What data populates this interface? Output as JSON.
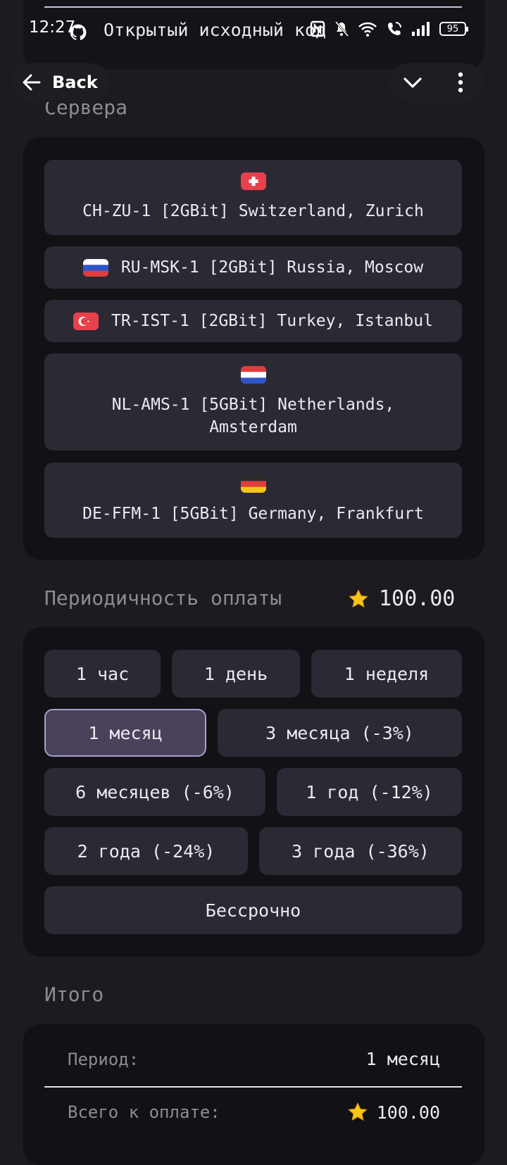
{
  "status_bar": {
    "time": "12:27",
    "battery": "95"
  },
  "top_card": {
    "title": "Открытый исходный код"
  },
  "nav": {
    "back_label": "Back"
  },
  "servers": {
    "section_title": "Сервера",
    "items": [
      {
        "label": "CH-ZU-1 [2GBit] Switzerland, Zurich",
        "flag": "switzerland-flag"
      },
      {
        "label": "RU-MSK-1 [2GBit] Russia, Moscow",
        "flag": "russia-flag"
      },
      {
        "label": "TR-IST-1 [2GBit] Turkey, Istanbul",
        "flag": "turkey-flag"
      },
      {
        "label_line1": "NL-AMS-1 [5GBit] Netherlands,",
        "label_line2": "Amsterdam",
        "flag": "netherlands-flag"
      },
      {
        "label": "DE-FFM-1 [5GBit] Germany, Frankfurt",
        "flag": "germany-flag"
      }
    ]
  },
  "payment": {
    "section_title": "Периодичность оплаты",
    "price": "100.00",
    "price_icon": "star-icon",
    "periods": [
      {
        "label": "1 час"
      },
      {
        "label": "1 день"
      },
      {
        "label": "1 неделя"
      },
      {
        "label": "1 месяц",
        "selected": true
      },
      {
        "label": "3 месяца (-3%)"
      },
      {
        "label": "6 месяцев (-6%)"
      },
      {
        "label": "1 год (-12%)"
      },
      {
        "label": "2 года (-24%)"
      },
      {
        "label": "3 года (-36%)"
      },
      {
        "label": "Бессрочно"
      }
    ]
  },
  "summary": {
    "section_title": "Итого",
    "period_label": "Период:",
    "period_value": "1 месяц",
    "total_label": "Всего к оплате:",
    "total_value": "100.00"
  },
  "colors": {
    "background": "#1c1b20",
    "card": "#121115",
    "button": "#2b2933",
    "selected": "#49425a",
    "selected_border": "#a99fd0",
    "star": "#f5c518"
  }
}
